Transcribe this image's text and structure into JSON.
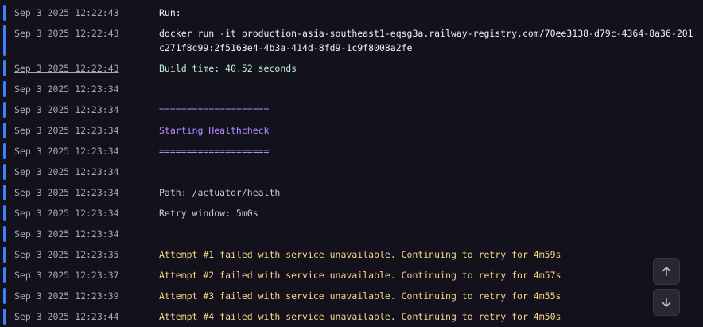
{
  "log": {
    "rows": [
      {
        "ts": "Sep 3 2025 12:22:43",
        "msg": "Run:",
        "tone": "plain"
      },
      {
        "ts": "Sep 3 2025 12:22:43",
        "msg": "docker run -it production-asia-southeast1-eqsg3a.railway-registry.com/70ee3138-d79c-4364-8a36-201c271f8c99:2f5163e4-4b3a-414d-8fd9-1c9f8008a2fe",
        "tone": "plain"
      },
      {
        "ts": "Sep 3 2025 12:22:43",
        "msg": "Build time: 40.52 seconds",
        "tone": "green"
      },
      {
        "ts": "Sep 3 2025 12:23:34",
        "msg": "",
        "tone": "plain"
      },
      {
        "ts": "Sep 3 2025 12:23:34",
        "msg": "====================",
        "tone": "purple"
      },
      {
        "ts": "Sep 3 2025 12:23:34",
        "msg": "Starting Healthcheck",
        "tone": "purple"
      },
      {
        "ts": "Sep 3 2025 12:23:34",
        "msg": "====================",
        "tone": "purple"
      },
      {
        "ts": "Sep 3 2025 12:23:34",
        "msg": "",
        "tone": "plain"
      },
      {
        "ts": "Sep 3 2025 12:23:34",
        "msg": "Path: /actuator/health",
        "tone": "dim"
      },
      {
        "ts": "Sep 3 2025 12:23:34",
        "msg": "Retry window: 5m0s",
        "tone": "dim"
      },
      {
        "ts": "Sep 3 2025 12:23:34",
        "msg": "",
        "tone": "plain"
      },
      {
        "ts": "Sep 3 2025 12:23:35",
        "msg": "Attempt #1 failed with service unavailable. Continuing to retry for 4m59s",
        "tone": "yellow"
      },
      {
        "ts": "Sep 3 2025 12:23:37",
        "msg": "Attempt #2 failed with service unavailable. Continuing to retry for 4m57s",
        "tone": "yellow"
      },
      {
        "ts": "Sep 3 2025 12:23:39",
        "msg": "Attempt #3 failed with service unavailable. Continuing to retry for 4m55s",
        "tone": "yellow"
      },
      {
        "ts": "Sep 3 2025 12:23:44",
        "msg": "Attempt #4 failed with service unavailable. Continuing to retry for 4m50s",
        "tone": "yellow"
      }
    ]
  },
  "controls": {
    "scroll_up_icon": "arrow-up-icon",
    "scroll_down_icon": "arrow-down-icon"
  },
  "colors": {
    "background": "#13111c",
    "severity_bar": "#3b82f6",
    "timestamp": "#a9a6b8",
    "success": "#bff0cf",
    "highlight": "#b58cff",
    "warning": "#f7d58a"
  }
}
